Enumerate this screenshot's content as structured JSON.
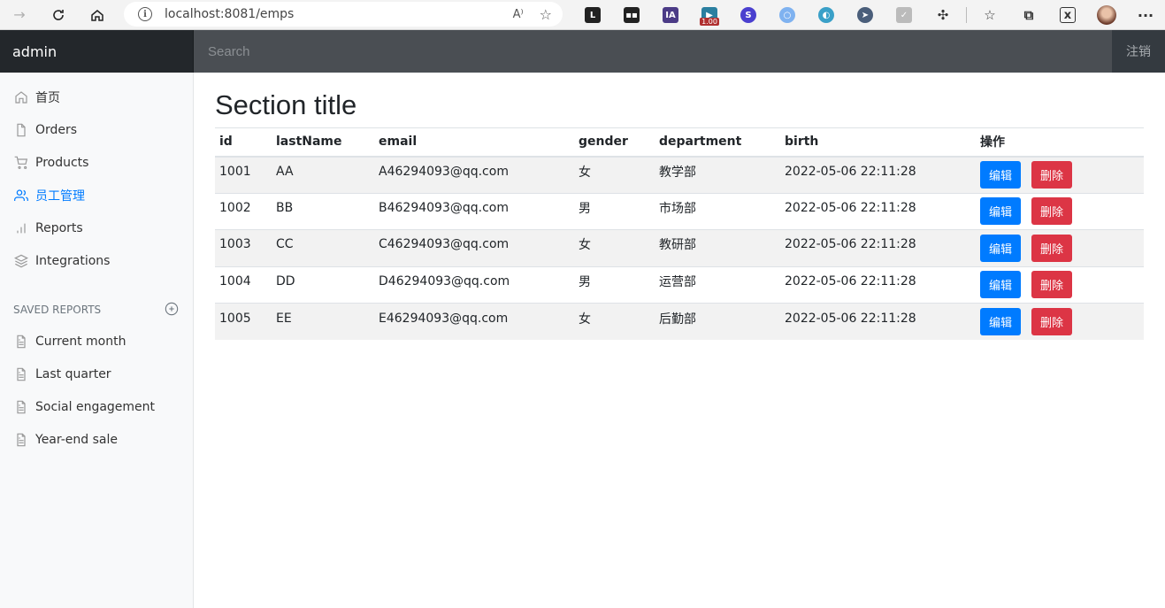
{
  "browser": {
    "url": "localhost:8081/emps",
    "read_aloud": "A⁾",
    "extension_badge": "1.00"
  },
  "navbar": {
    "brand": "admin",
    "search_placeholder": "Search",
    "signout": "注销"
  },
  "sidebar": {
    "items": [
      {
        "label": "首页",
        "icon": "home-icon"
      },
      {
        "label": "Orders",
        "icon": "file-icon"
      },
      {
        "label": "Products",
        "icon": "cart-icon"
      },
      {
        "label": "员工管理",
        "icon": "users-icon",
        "active": true
      },
      {
        "label": "Reports",
        "icon": "bar-chart-icon"
      },
      {
        "label": "Integrations",
        "icon": "layers-icon"
      }
    ],
    "saved_header": "Saved reports",
    "saved": [
      {
        "label": "Current month",
        "icon": "file-text-icon"
      },
      {
        "label": "Last quarter",
        "icon": "file-text-icon"
      },
      {
        "label": "Social engagement",
        "icon": "file-text-icon"
      },
      {
        "label": "Year-end sale",
        "icon": "file-text-icon"
      }
    ]
  },
  "main": {
    "title": "Section title",
    "columns": [
      "id",
      "lastName",
      "email",
      "gender",
      "department",
      "birth",
      "操作"
    ],
    "rows": [
      {
        "id": "1001",
        "lastName": "AA",
        "email": "A46294093@qq.com",
        "gender": "女",
        "department": "教学部",
        "birth": "2022-05-06 22:11:28"
      },
      {
        "id": "1002",
        "lastName": "BB",
        "email": "B46294093@qq.com",
        "gender": "男",
        "department": "市场部",
        "birth": "2022-05-06 22:11:28"
      },
      {
        "id": "1003",
        "lastName": "CC",
        "email": "C46294093@qq.com",
        "gender": "女",
        "department": "教研部",
        "birth": "2022-05-06 22:11:28"
      },
      {
        "id": "1004",
        "lastName": "DD",
        "email": "D46294093@qq.com",
        "gender": "男",
        "department": "运营部",
        "birth": "2022-05-06 22:11:28"
      },
      {
        "id": "1005",
        "lastName": "EE",
        "email": "E46294093@qq.com",
        "gender": "女",
        "department": "后勤部",
        "birth": "2022-05-06 22:11:28"
      }
    ],
    "edit_label": "编辑",
    "delete_label": "删除"
  },
  "colors": {
    "primary": "#007bff",
    "danger": "#dc3545",
    "navbar": "#343a40"
  }
}
